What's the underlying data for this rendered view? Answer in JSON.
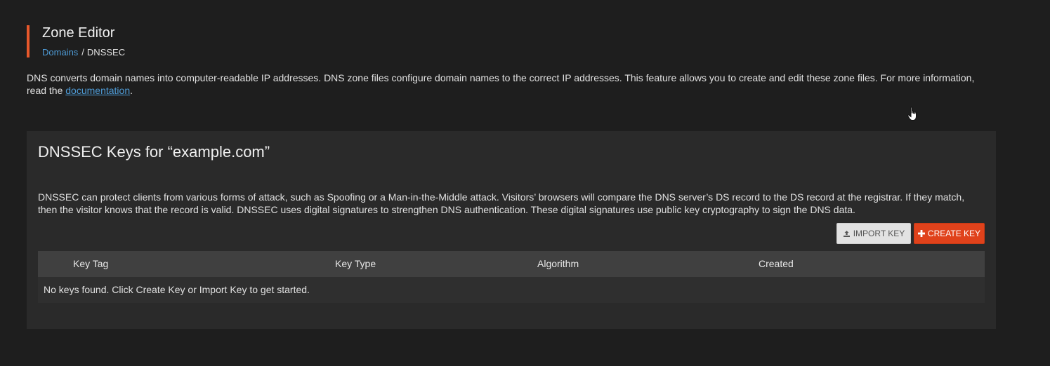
{
  "header": {
    "title": "Zone Editor",
    "accent_color": "#e8582b",
    "breadcrumb": {
      "link": "Domains",
      "separator": "/",
      "current": "DNSSEC"
    }
  },
  "intro": {
    "text": "DNS converts domain names into computer-readable IP addresses. DNS zone files configure domain names to the correct IP addresses. This feature allows you to create and edit these zone files. For more information, read the ",
    "link": "documentation",
    "suffix": "."
  },
  "panel": {
    "title": "DNSSEC Keys for “example.com”",
    "description": "DNSSEC can protect clients from various forms of attack, such as Spoofing or a Man-in-the-Middle attack. Visitors’ browsers will compare the DNS server’s DS record to the DS record at the registrar. If they match, then the visitor knows that the record is valid. DNSSEC uses digital signatures to strengthen DNS authentication. These digital signatures use public key cryptography to sign the DNS data.",
    "buttons": {
      "import": {
        "label": "IMPORT KEY",
        "icon": "upload-icon"
      },
      "create": {
        "label": "CREATE KEY",
        "icon": "plus-icon",
        "color": "#e0421b"
      }
    },
    "table": {
      "columns": [
        "Key Tag",
        "Key Type",
        "Algorithm",
        "Created"
      ],
      "empty_message": "No keys found. Click Create Key or Import Key to get started."
    }
  }
}
